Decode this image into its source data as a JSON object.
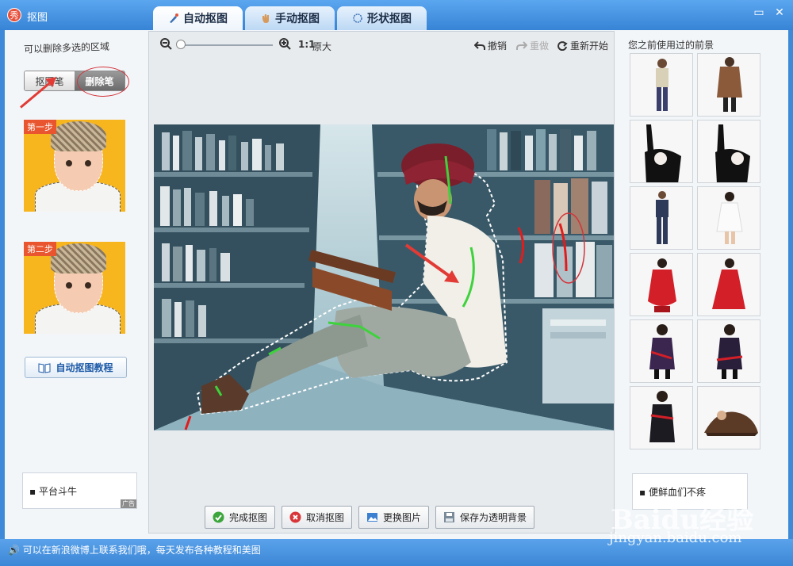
{
  "app": {
    "title": "抠图",
    "logo_glyph": "秀"
  },
  "tabs": [
    {
      "label": "自动抠图",
      "active": true,
      "icon": "brush-icon"
    },
    {
      "label": "手动抠图",
      "active": false,
      "icon": "hand-icon"
    },
    {
      "label": "形状抠图",
      "active": false,
      "icon": "shape-icon"
    }
  ],
  "window_controls": {
    "restore": "▭",
    "close": "✕"
  },
  "left_panel": {
    "hint": "可以删除多选的区域",
    "pen_tool": "抠图笔",
    "erase_tool": "删除笔",
    "step1": "第一步",
    "step2": "第二步",
    "tutorial_button": "自动抠图教程",
    "ad_text": "平台斗牛",
    "ad_tag": "广告"
  },
  "toolbar": {
    "zoom_ratio": "1:1",
    "original_size": "原大",
    "undo": "撤销",
    "redo": "重做",
    "restart": "重新开始"
  },
  "bottom_buttons": {
    "finish": "完成抠图",
    "cancel": "取消抠图",
    "change_image": "更换图片",
    "save_transparent": "保存为透明背景"
  },
  "right_panel": {
    "recent_label": "您之前使用过的前景",
    "ad_text": "便鲜血们不疼"
  },
  "statusbar": {
    "text": "可以在新浪微博上联系我们哦，每天发布各种教程和美图"
  },
  "watermark": {
    "main": "Baidu经验",
    "sub": "jingyan.baidu.com"
  }
}
